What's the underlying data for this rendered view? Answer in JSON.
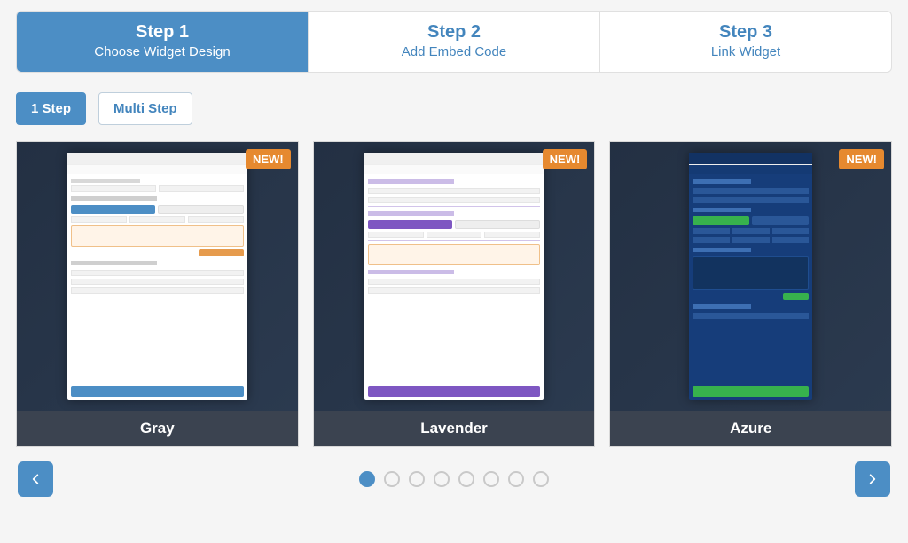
{
  "steps": [
    {
      "title": "Step 1",
      "sub": "Choose Widget Design"
    },
    {
      "title": "Step 2",
      "sub": "Add Embed Code"
    },
    {
      "title": "Step 3",
      "sub": "Link Widget"
    }
  ],
  "subtabs": {
    "one": "1 Step",
    "multi": "Multi Step"
  },
  "badge": "NEW!",
  "designs": [
    {
      "name": "Gray",
      "theme": "gray"
    },
    {
      "name": "Lavender",
      "theme": "lavender"
    },
    {
      "name": "Azure",
      "theme": "azure"
    }
  ],
  "carousel": {
    "pages": 8,
    "active_index": 0
  }
}
